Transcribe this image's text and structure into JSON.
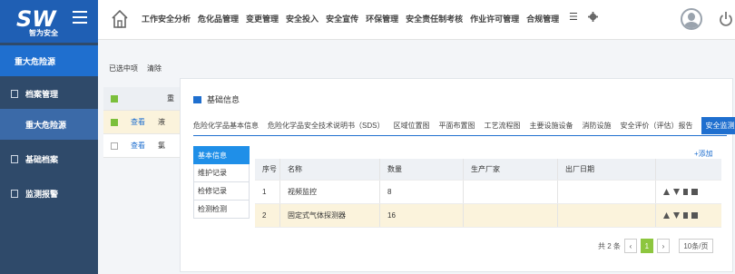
{
  "brand": {
    "logo_text": "SW",
    "subtitle": "智为安全"
  },
  "sidebar": {
    "group_label": "重大危险源",
    "items": [
      {
        "label": "档案管理"
      },
      {
        "label": "重大危险源"
      },
      {
        "label": "基础档案"
      },
      {
        "label": "监测报警"
      }
    ]
  },
  "topnav": {
    "items": [
      "工作安全分析",
      "危化品管理",
      "变更管理",
      "安全投入",
      "安全宣传",
      "环保管理",
      "安全责任制考核",
      "作业许可管理",
      "合规管理"
    ],
    "more_label": "☰"
  },
  "under": {
    "tabs": [
      "已选中项",
      "清除"
    ],
    "rows": [
      {
        "check": "",
        "link": "",
        "text": "重"
      },
      {
        "check": "on",
        "link": "查看",
        "text": "液"
      },
      {
        "check": "",
        "link": "查看",
        "text": "氯"
      }
    ]
  },
  "panel": {
    "title": "基础信息",
    "tabs": [
      "危险化学品基本信息",
      "危险化学品安全技术说明书（SDS）",
      "区域位置图",
      "平面布置图",
      "工艺流程图",
      "主要设施设备",
      "消防设施",
      "安全评价（评估）报告",
      "安全监测监控系统"
    ],
    "add_label": "+添加",
    "side_tabs": [
      "基本信息",
      "维护记录",
      "检修记录",
      "检测检测"
    ],
    "columns": [
      "序号",
      "名称",
      "数量",
      "生产厂家",
      "出厂日期",
      ""
    ],
    "rows": [
      {
        "no": "1",
        "name": "视频监控",
        "qty": "8",
        "maker": "",
        "date": ""
      },
      {
        "no": "2",
        "name": "固定式气体探测器",
        "qty": "16",
        "maker": "",
        "date": ""
      }
    ],
    "pager": {
      "total": "共 2 条",
      "prev": "‹",
      "page": "1",
      "next": "›",
      "size": "10条/页"
    }
  },
  "colors": {
    "brand_blue": "#1f6fcf",
    "sidebar": "#2f4a6a",
    "active_page": "#8dc63f"
  }
}
